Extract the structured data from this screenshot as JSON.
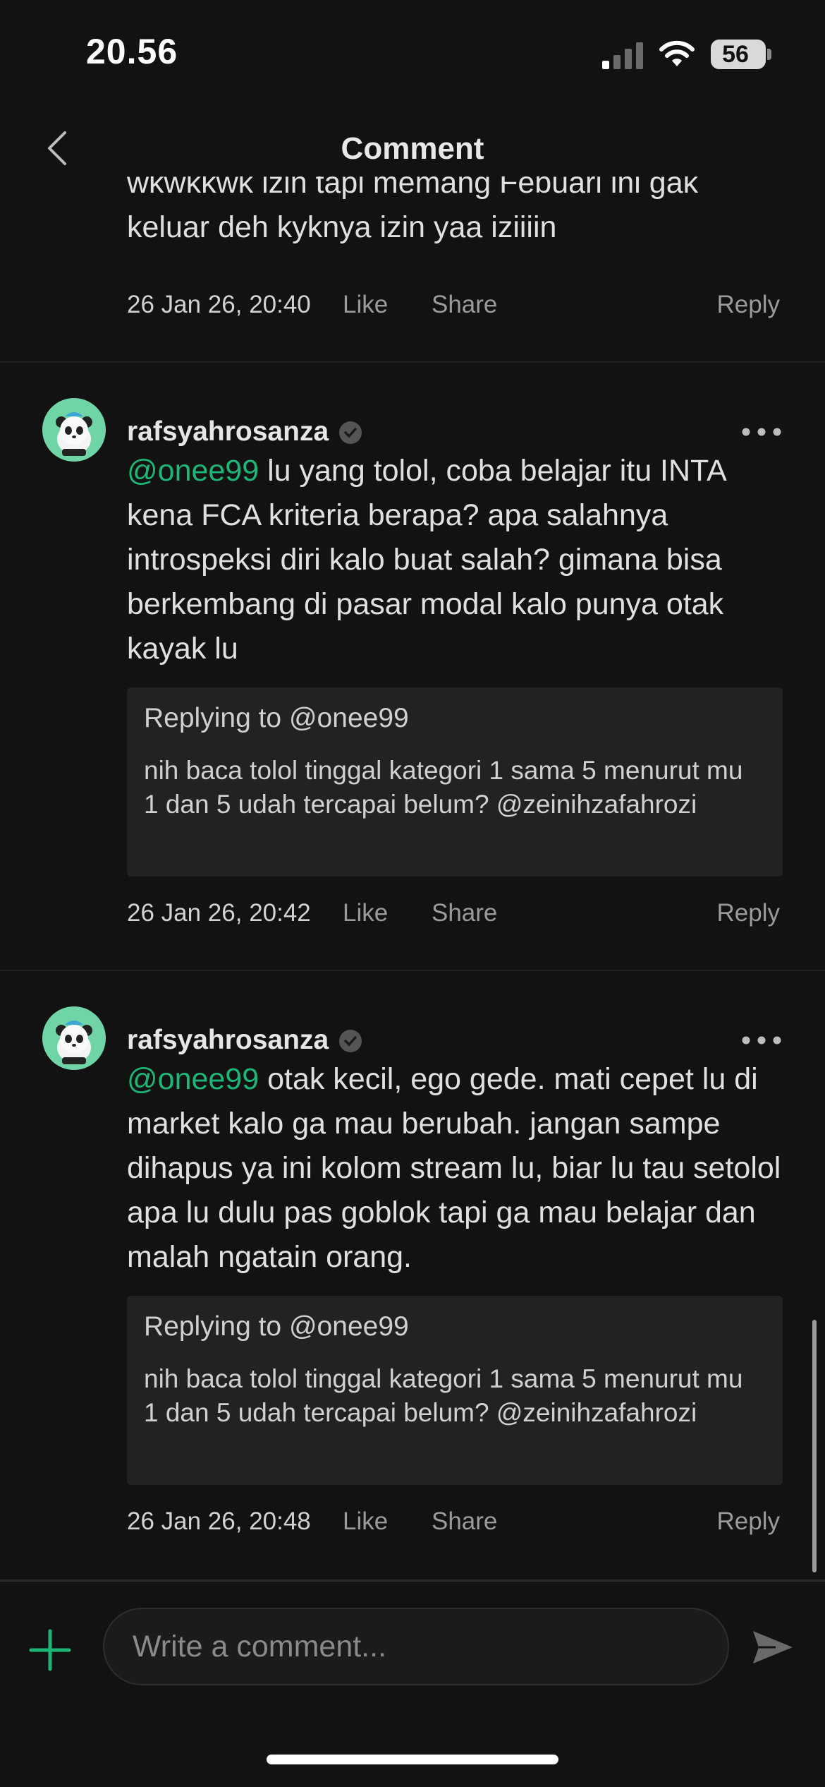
{
  "status_bar": {
    "time": "20.56",
    "battery": "56"
  },
  "header": {
    "title": "Comment"
  },
  "partial_comment": {
    "text": "wkwkkwk izin tapi memang Febuari ini gak keluar deh kyknya izin yaa iziiiin",
    "date": "26 Jan 26, 20:40",
    "like": "Like",
    "share": "Share",
    "reply": "Reply"
  },
  "comments": [
    {
      "username": "rafsyahrosanza",
      "mention": "@onee99",
      "text": " lu yang tolol, coba belajar itu INTA kena FCA kriteria berapa? apa salahnya introspeksi diri kalo buat salah? gimana bisa berkembang di pasar modal kalo punya otak kayak lu",
      "replying_label": "Replying to",
      "replying_user": "@onee99",
      "reply_text": "nih baca tolol tinggal kategori 1 sama 5 menurut mu 1 dan 5 udah tercapai belum? @zeinihzafahrozi",
      "date": "26 Jan 26, 20:42",
      "like": "Like",
      "share": "Share",
      "reply": "Reply"
    },
    {
      "username": "rafsyahrosanza",
      "mention": "@onee99",
      "text": " otak kecil, ego gede. mati cepet lu di market kalo ga mau berubah. jangan sampe dihapus ya ini kolom stream lu, biar lu tau setolol apa lu dulu pas goblok tapi ga mau belajar dan malah ngatain orang.",
      "replying_label": "Replying to",
      "replying_user": "@onee99",
      "reply_text": "nih baca tolol tinggal kategori 1 sama 5 menurut mu 1 dan 5 udah tercapai belum? @zeinihzafahrozi",
      "date": "26 Jan 26, 20:48",
      "like": "Like",
      "share": "Share",
      "reply": "Reply"
    }
  ],
  "composer": {
    "placeholder": "Write a comment..."
  },
  "colors": {
    "accent": "#1db676",
    "background": "#121212",
    "avatar_bg": "#6fd4a6"
  },
  "icons": [
    "back-icon",
    "verified-icon",
    "more-icon",
    "plus-icon",
    "send-icon",
    "signal-icon",
    "wifi-icon"
  ]
}
